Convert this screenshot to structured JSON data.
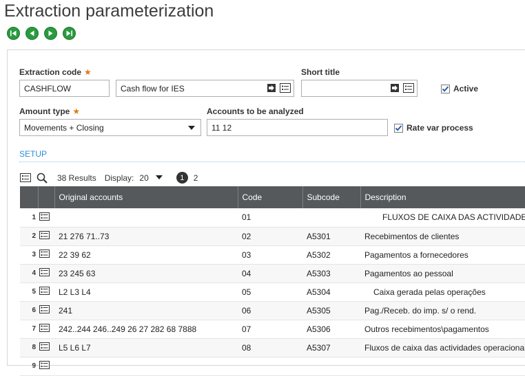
{
  "page": {
    "title": "Extraction parameterization"
  },
  "form": {
    "extraction_code_label": "Extraction code",
    "extraction_code_value": "CASHFLOW",
    "description_value": "Cash flow  for IES",
    "short_title_label": "Short title",
    "short_title_value": "",
    "active_label": "Active",
    "active_checked": true,
    "amount_type_label": "Amount type",
    "amount_type_value": "Movements + Closing",
    "accounts_label": "Accounts to be analyzed",
    "accounts_value": "11 12",
    "rate_var_label": "Rate var process",
    "rate_var_checked": true
  },
  "section": {
    "setup_label": "SETUP"
  },
  "grid": {
    "results": "38 Results",
    "display_label": "Display:",
    "display_value": "20",
    "pages": [
      "1",
      "2"
    ],
    "columns": [
      "Original accounts",
      "Code",
      "Subcode",
      "Description"
    ],
    "rows": [
      {
        "n": "1",
        "accounts": "",
        "code": "01",
        "subcode": "",
        "description": "FLUXOS DE CAIXA DAS ACTIVIDADES OPERACIONAIS"
      },
      {
        "n": "2",
        "accounts": "21 276 71..73",
        "code": "02",
        "subcode": "A5301",
        "description": "Recebimentos de clientes"
      },
      {
        "n": "3",
        "accounts": "22 39 62",
        "code": "03",
        "subcode": "A5302",
        "description": "Pagamentos a fornecedores"
      },
      {
        "n": "4",
        "accounts": "23 245 63",
        "code": "04",
        "subcode": "A5303",
        "description": "Pagamentos ao pessoal"
      },
      {
        "n": "5",
        "accounts": "L2 L3 L4",
        "code": "05",
        "subcode": "A5304",
        "description": "Caixa gerada pelas operações"
      },
      {
        "n": "6",
        "accounts": "241",
        "code": "06",
        "subcode": "A5305",
        "description": "Pag./Receb. do imp. s/ o rend."
      },
      {
        "n": "7",
        "accounts": "242..244 246..249 26 27 282 68 7888",
        "code": "07",
        "subcode": "A5306",
        "description": "Outros recebimentos\\pagamentos"
      },
      {
        "n": "8",
        "accounts": "L5 L6 L7",
        "code": "08",
        "subcode": "A5307",
        "description": "Fluxos de caixa das actividades operacionais"
      },
      {
        "n": "9",
        "accounts": "",
        "code": "",
        "subcode": "",
        "description": ""
      }
    ]
  }
}
